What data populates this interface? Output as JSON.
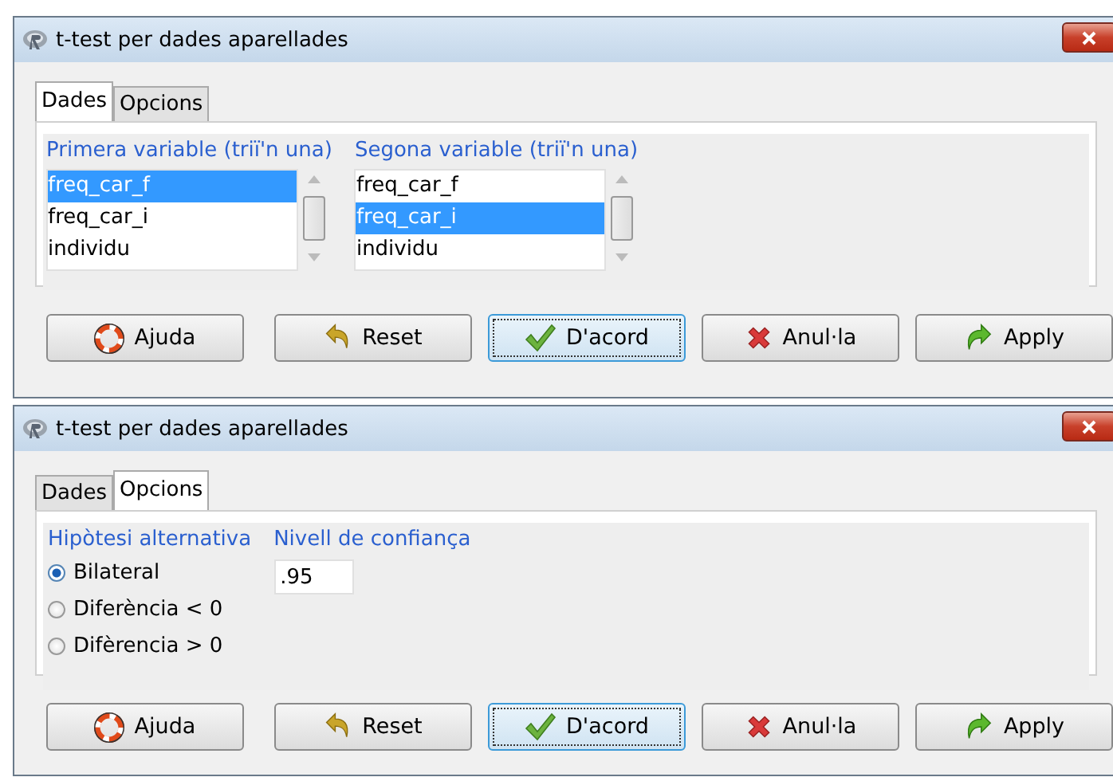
{
  "windows": [
    {
      "title": "t-test per dades aparellades",
      "tabs": [
        {
          "label": "Dades",
          "selected": true
        },
        {
          "label": "Opcions",
          "selected": false
        }
      ],
      "kind": "data",
      "lists": [
        {
          "label": "Primera variable (triï'n una)",
          "items": [
            {
              "label": "freq_car_f",
              "selected": true
            },
            {
              "label": "freq_car_i",
              "selected": false
            },
            {
              "label": "individu",
              "selected": false
            }
          ]
        },
        {
          "label": "Segona variable (triï'n una)",
          "items": [
            {
              "label": "freq_car_f",
              "selected": false
            },
            {
              "label": "freq_car_i",
              "selected": true
            },
            {
              "label": "individu",
              "selected": false
            }
          ]
        }
      ],
      "buttons": [
        {
          "kind": "help",
          "label": "Ajuda",
          "focused": false
        },
        {
          "kind": "reset",
          "label": "Reset",
          "focused": false
        },
        {
          "kind": "ok",
          "label": "D'acord",
          "focused": true
        },
        {
          "kind": "cancel",
          "label": "Anul·la",
          "focused": false
        },
        {
          "kind": "apply",
          "label": "Apply",
          "focused": false
        }
      ]
    },
    {
      "title": "t-test per dades aparellades",
      "tabs": [
        {
          "label": "Dades",
          "selected": false
        },
        {
          "label": "Opcions",
          "selected": true
        }
      ],
      "kind": "options",
      "radio_label": "Hipòtesi alternativa",
      "radios": [
        {
          "label": "Bilateral",
          "selected": true
        },
        {
          "label": "Diferència < 0",
          "selected": false
        },
        {
          "label": "Difèrencia > 0",
          "selected": false
        }
      ],
      "confidence": {
        "label": "Nivell de confiança",
        "value": ".95"
      },
      "buttons": [
        {
          "kind": "help",
          "label": "Ajuda",
          "focused": false
        },
        {
          "kind": "reset",
          "label": "Reset",
          "focused": false
        },
        {
          "kind": "ok",
          "label": "D'acord",
          "focused": true
        },
        {
          "kind": "cancel",
          "label": "Anul·la",
          "focused": false
        },
        {
          "kind": "apply",
          "label": "Apply",
          "focused": false
        }
      ]
    }
  ]
}
